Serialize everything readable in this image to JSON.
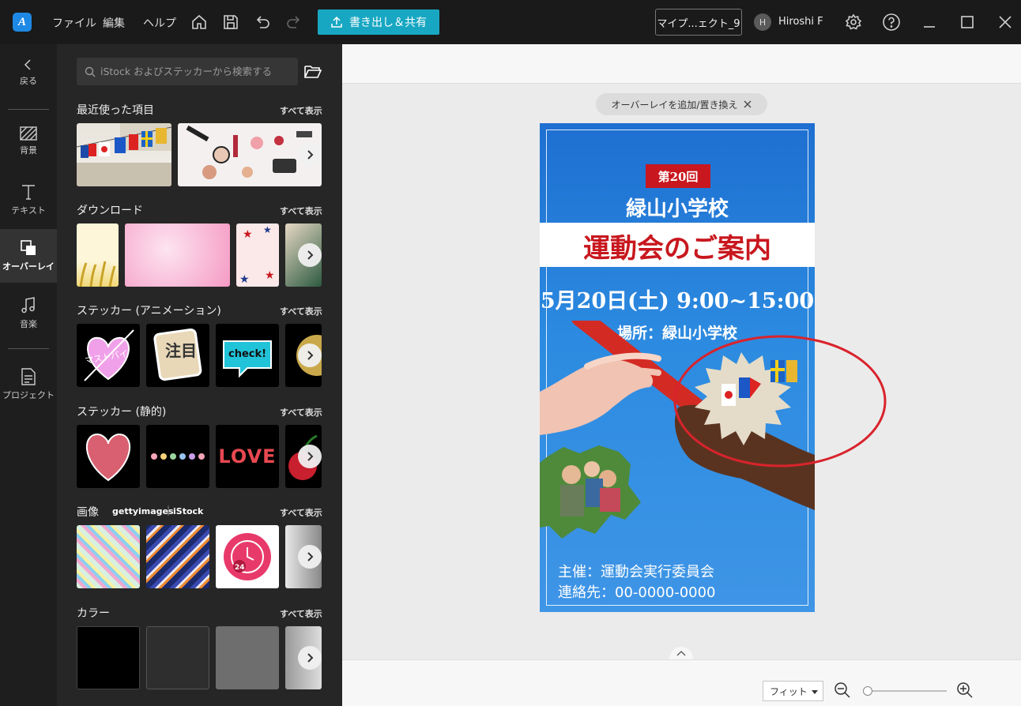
{
  "topbar": {
    "menu": [
      "ファイル",
      "編集",
      "ヘルプ"
    ],
    "share_label": "書き出し＆共有",
    "project_name": "マイプ...ェクト_9",
    "user_initial": "H",
    "user_name": "Hiroshi F"
  },
  "rail": {
    "back": "戻る",
    "items": [
      "背景",
      "テキスト",
      "オーバーレイ",
      "音楽",
      "プロジェクト"
    ],
    "active": "オーバーレイ"
  },
  "panel": {
    "search_placeholder": "iStock およびステッカーから検索する",
    "show_all": "すべて表示",
    "sections": [
      "最近使った項目",
      "ダウンロード",
      "ステッカー (アニメーション)",
      "ステッカー (静的)",
      "画像",
      "カラー"
    ],
    "image_sources": [
      "gettyimages",
      "iStock"
    ],
    "sticker_texts": [
      "マストバイ",
      "注目",
      "check!",
      "LOVE"
    ]
  },
  "canvas": {
    "overlay_chip": "オーバーレイを追加/置き換え",
    "zoom_mode": "フィット"
  },
  "poster": {
    "edition": "第20回",
    "school": "緑山小学校",
    "title": "運動会のご案内",
    "date": "5月20日(土) 9:00~15:00",
    "place": "場所：緑山小学校",
    "organizer": "主催：運動会実行委員会",
    "contact": "連絡先：00-0000-0000"
  },
  "colors": {
    "accent": "#18a7c2",
    "poster_blue": "#1e6fd1",
    "poster_red": "#c8171e",
    "annotation_red": "#d9232c"
  }
}
